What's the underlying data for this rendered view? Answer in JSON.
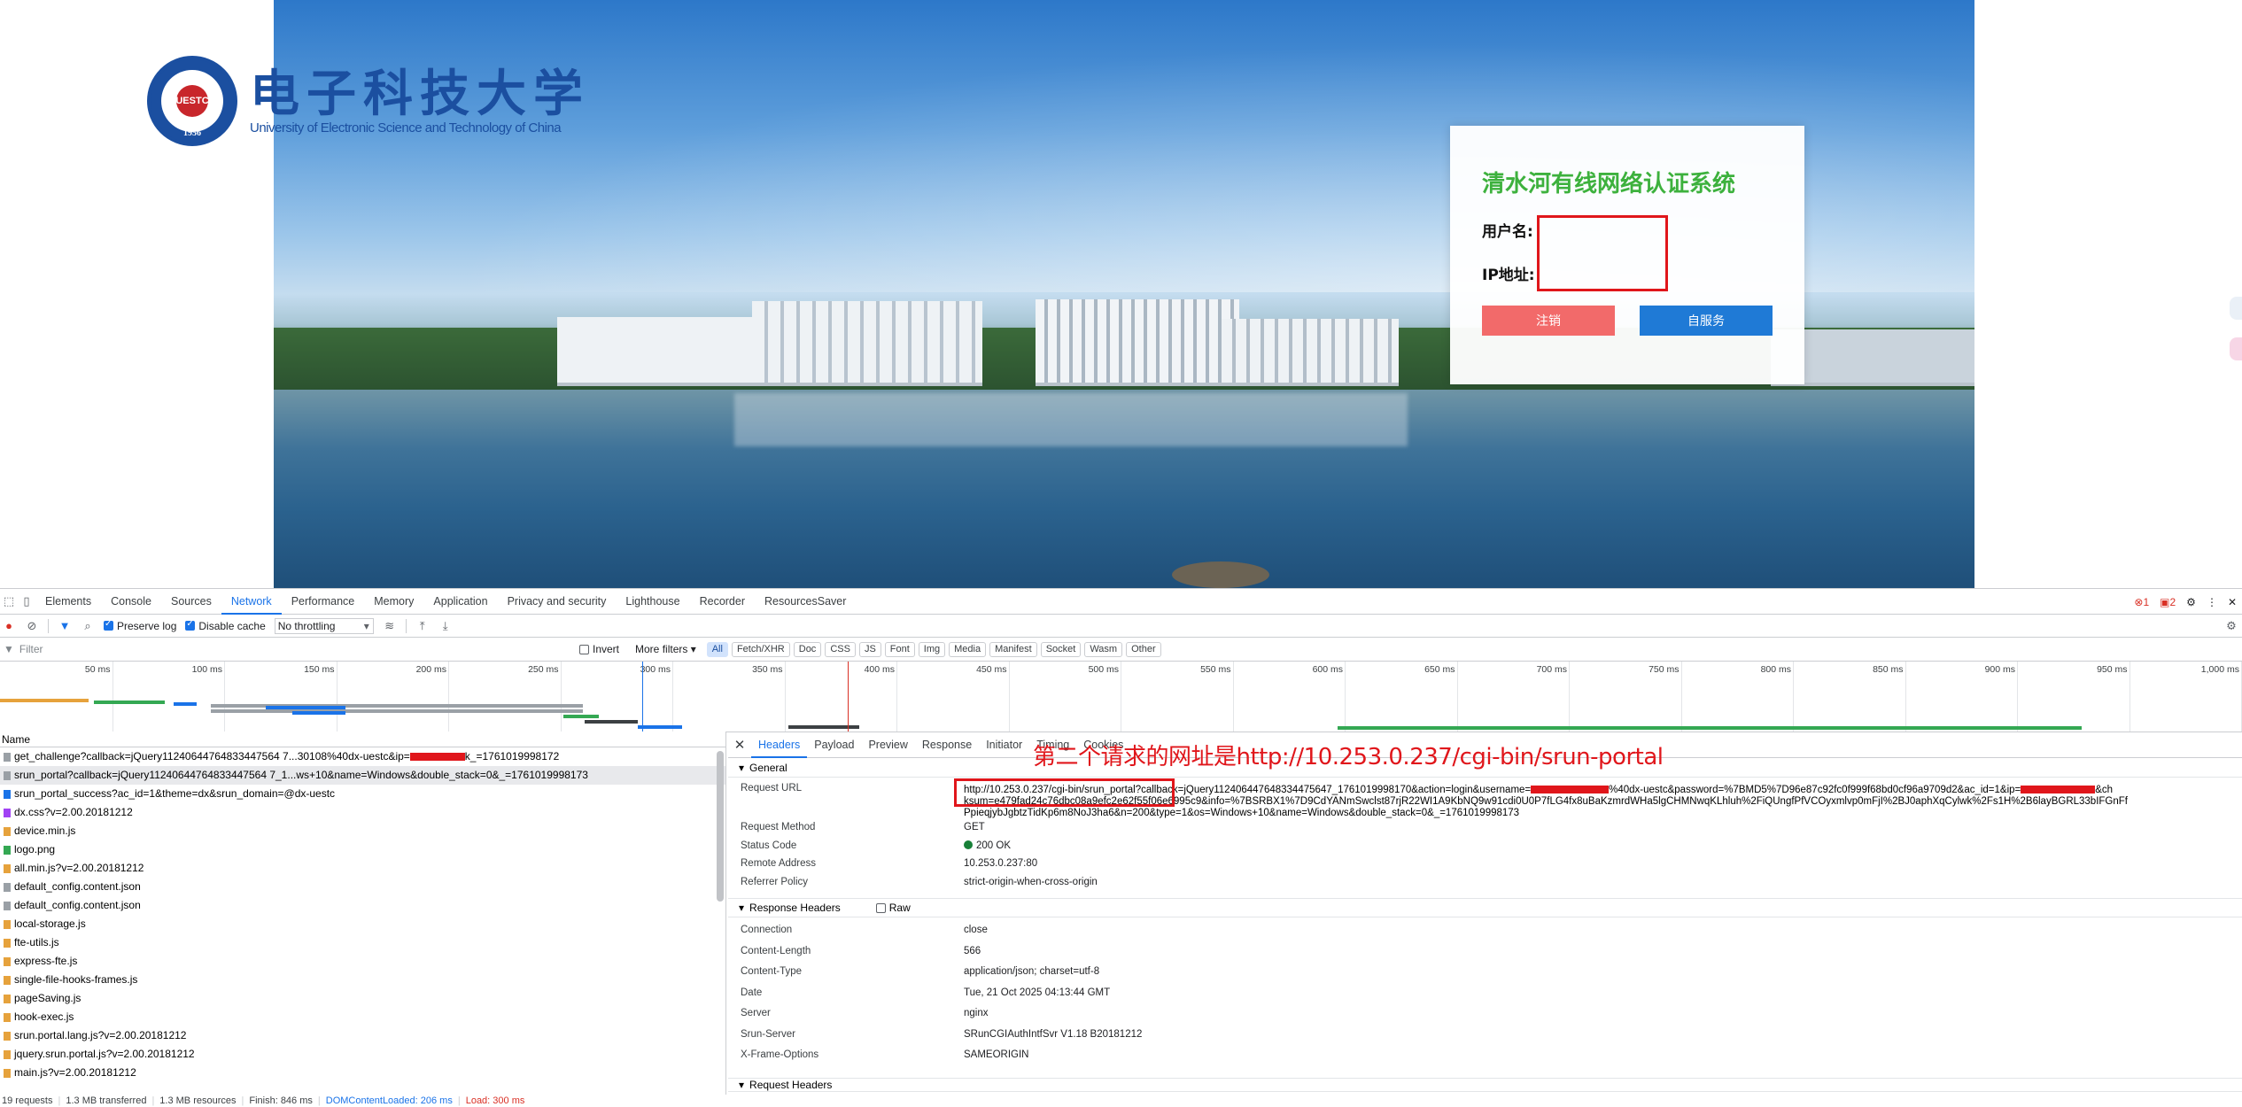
{
  "page": {
    "logo": {
      "seal_text": "UESTC",
      "seal_year": "1956",
      "cn_name": "电子科技大学",
      "en_name": "University of Electronic Science and Technology of China"
    },
    "login": {
      "title": "清水河有线网络认证系统",
      "username_label": "用户名:",
      "ip_label": "IP地址:",
      "logout_button": "注销",
      "selfservice_button": "自服务"
    }
  },
  "devtools": {
    "tabs": [
      "Elements",
      "Console",
      "Sources",
      "Network",
      "Performance",
      "Memory",
      "Application",
      "Privacy and security",
      "Lighthouse",
      "Recorder",
      "ResourcesSaver"
    ],
    "active_tab": "Network",
    "errors": "1",
    "warnings": "2",
    "toolbar": {
      "preserve_log": "Preserve log",
      "disable_cache": "Disable cache",
      "throttling": "No throttling"
    },
    "filter": {
      "placeholder": "Filter",
      "invert": "Invert",
      "more_filters": "More filters",
      "chips": [
        "All",
        "Fetch/XHR",
        "Doc",
        "CSS",
        "JS",
        "Font",
        "Img",
        "Media",
        "Manifest",
        "Socket",
        "Wasm",
        "Other"
      ]
    },
    "timeline_ticks": [
      "50 ms",
      "100 ms",
      "150 ms",
      "200 ms",
      "250 ms",
      "300 ms",
      "350 ms",
      "400 ms",
      "450 ms",
      "500 ms",
      "550 ms",
      "600 ms",
      "650 ms",
      "700 ms",
      "750 ms",
      "800 ms",
      "850 ms",
      "900 ms",
      "950 ms",
      "1,000 ms"
    ],
    "request_list": {
      "header": "Name",
      "rows": [
        {
          "name_a": "get_challenge?callback=jQuery11240644764833447564 7...30108%40dx-uestc&ip=",
          "name_b": "k_=1761019998172",
          "redacted": true
        },
        {
          "name_a": "srun_portal?callback=jQuery11240644764833447564 7_1...ws+10&name=Windows&double_stack=0&_=1761019998173",
          "name_b": "",
          "redacted": false
        },
        {
          "name_a": "srun_portal_success?ac_id=1&theme=dx&srun_domain=@dx-uestc",
          "name_b": "",
          "redacted": false
        },
        {
          "name_a": "dx.css?v=2.00.20181212",
          "name_b": "",
          "redacted": false
        },
        {
          "name_a": "device.min.js",
          "name_b": "",
          "redacted": false
        },
        {
          "name_a": "logo.png",
          "name_b": "",
          "redacted": false
        },
        {
          "name_a": "all.min.js?v=2.00.20181212",
          "name_b": "",
          "redacted": false
        },
        {
          "name_a": "default_config.content.json",
          "name_b": "",
          "redacted": false
        },
        {
          "name_a": "default_config.content.json",
          "name_b": "",
          "redacted": false
        },
        {
          "name_a": "local-storage.js",
          "name_b": "",
          "redacted": false
        },
        {
          "name_a": "fte-utils.js",
          "name_b": "",
          "redacted": false
        },
        {
          "name_a": "express-fte.js",
          "name_b": "",
          "redacted": false
        },
        {
          "name_a": "single-file-hooks-frames.js",
          "name_b": "",
          "redacted": false
        },
        {
          "name_a": "pageSaving.js",
          "name_b": "",
          "redacted": false
        },
        {
          "name_a": "hook-exec.js",
          "name_b": "",
          "redacted": false
        },
        {
          "name_a": "srun.portal.lang.js?v=2.00.20181212",
          "name_b": "",
          "redacted": false
        },
        {
          "name_a": "jquery.srun.portal.js?v=2.00.20181212",
          "name_b": "",
          "redacted": false
        },
        {
          "name_a": "main.js?v=2.00.20181212",
          "name_b": "",
          "redacted": false
        }
      ]
    },
    "details": {
      "tabs": [
        "Headers",
        "Payload",
        "Preview",
        "Response",
        "Initiator",
        "Timing",
        "Cookies"
      ],
      "active_tab": "Headers",
      "general_title": "General",
      "request_url_label": "Request URL",
      "request_url_line1a": "http://10.253.0.237/cgi-bin/srun_portal?callback=jQuery112406447648334475647_1761019998170&action=login&username=",
      "request_url_line1b": "%40dx-uestc&password=%7BMD5%7D96e87c92fc0f999f68bd0cf96a9709d2&ac_id=1&ip=",
      "request_url_line1c": "&ch",
      "request_url_line2": "ksum=e479fad24c76dbc08a9efc2e62f55f06e6995c9&info=%7BSRBX1%7D9CdYANmSwclst87rjR22WI1A9KbNQ9w91cdi0U0P7fLG4fx8uBaKzmrdWHa5lgCHMNwqKLhluh%2FiQUngfPfVCOyxmlvp0mFjI%2BJ0aphXqCylwk%2Fs1H%2B6layBGRL33bIFGnFf",
      "request_url_line3": "PpieqjybJgbtzTidKp6m8NoJ3ha6&n=200&type=1&os=Windows+10&name=Windows&double_stack=0&_=1761019998173",
      "general_rows": [
        {
          "k": "Request Method",
          "v": "GET"
        },
        {
          "k": "Status Code",
          "v": "200 OK"
        },
        {
          "k": "Remote Address",
          "v": "10.253.0.237:80"
        },
        {
          "k": "Referrer Policy",
          "v": "strict-origin-when-cross-origin"
        }
      ],
      "response_headers_title": "Response Headers",
      "raw_label": "Raw",
      "response_rows": [
        {
          "k": "Connection",
          "v": "close"
        },
        {
          "k": "Content-Length",
          "v": "566"
        },
        {
          "k": "Content-Type",
          "v": "application/json; charset=utf-8"
        },
        {
          "k": "Date",
          "v": "Tue, 21 Oct 2025 04:13:44 GMT"
        },
        {
          "k": "Server",
          "v": "nginx"
        },
        {
          "k": "Srun-Server",
          "v": "SRunCGIAuthIntfSvr V1.18 B20181212"
        },
        {
          "k": "X-Frame-Options",
          "v": "SAMEORIGIN"
        }
      ],
      "request_headers_title": "Request Headers"
    },
    "annotation": "第二个请求的网址是http://10.253.0.237/cgi-bin/srun-portal",
    "statusbar": {
      "requests": "19 requests",
      "transferred": "1.3 MB transferred",
      "resources": "1.3 MB resources",
      "finish": "Finish: 846 ms",
      "dcl": "DOMContentLoaded: 206 ms",
      "load": "Load: 300 ms"
    }
  }
}
